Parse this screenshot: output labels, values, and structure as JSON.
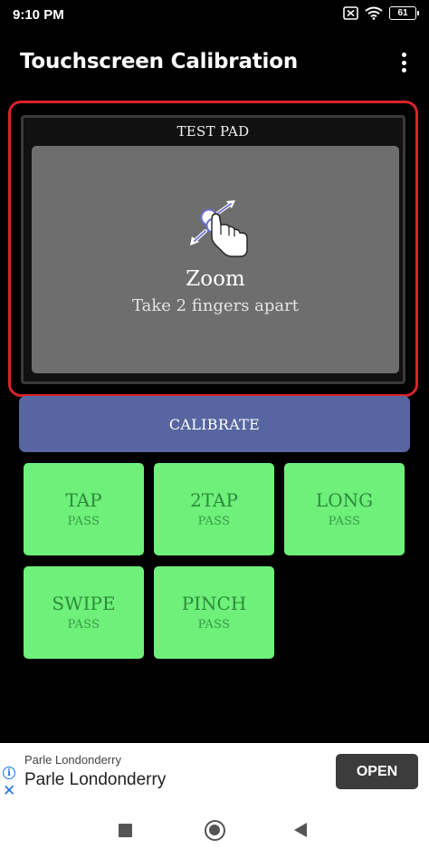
{
  "status_bar": {
    "time": "9:10 PM",
    "battery": "61",
    "icons": [
      "sim-off-icon",
      "wifi-icon",
      "battery-icon"
    ]
  },
  "app_bar": {
    "title": "Touchscreen Calibration",
    "menu_icon": "more-vert-icon"
  },
  "test_pad": {
    "label": "TEST PAD",
    "gesture_icon": "pinch-zoom-icon",
    "gesture_title": "Zoom",
    "gesture_hint": "Take 2 fingers apart"
  },
  "calibrate": {
    "label": "CALIBRATE"
  },
  "tests": [
    {
      "name": "TAP",
      "status": "PASS"
    },
    {
      "name": "2TAP",
      "status": "PASS"
    },
    {
      "name": "LONG",
      "status": "PASS"
    },
    {
      "name": "SWIPE",
      "status": "PASS"
    },
    {
      "name": "PINCH",
      "status": "PASS"
    }
  ],
  "ad": {
    "advertiser_small": "Parle Londonderry",
    "advertiser": "Parle Londonderry",
    "cta": "OPEN"
  },
  "colors": {
    "background": "#000000",
    "test_pad_border": "#d9222a",
    "calibrate_button": "#5766a0",
    "tile_pass": "#6ef07a",
    "tile_text": "#2e8a3b"
  }
}
